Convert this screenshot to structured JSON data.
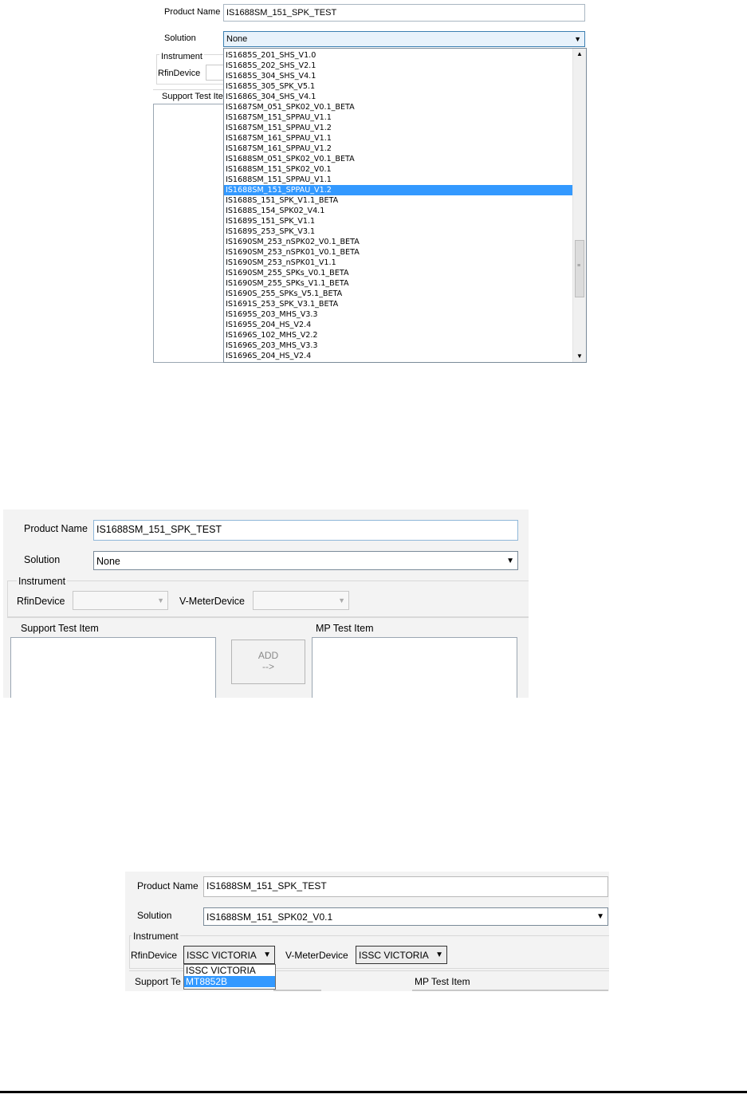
{
  "panel1": {
    "product_name_label": "Product Name",
    "product_name_value": "IS1688SM_151_SPK_TEST",
    "solution_label": "Solution",
    "solution_value": "None",
    "instrument_label": "Instrument",
    "rfin_label": "RfinDevice",
    "support_label": "Support Test Ite",
    "dropdown_items": [
      "IS1685S_201_SHS_V1.0",
      "IS1685S_202_SHS_V2.1",
      "IS1685S_304_SHS_V4.1",
      "IS1685S_305_SPK_V5.1",
      "IS1686S_304_SHS_V4.1",
      "IS1687SM_051_SPK02_V0.1_BETA",
      "IS1687SM_151_SPPAU_V1.1",
      "IS1687SM_151_SPPAU_V1.2",
      "IS1687SM_161_SPPAU_V1.1",
      "IS1687SM_161_SPPAU_V1.2",
      "IS1688SM_051_SPK02_V0.1_BETA",
      "IS1688SM_151_SPK02_V0.1",
      "IS1688SM_151_SPPAU_V1.1",
      "IS1688SM_151_SPPAU_V1.2",
      "IS1688S_151_SPK_V1.1_BETA",
      "IS1688S_154_SPK02_V4.1",
      "IS1689S_151_SPK_V1.1",
      "IS1689S_253_SPK_V3.1",
      "IS1690SM_253_nSPK02_V0.1_BETA",
      "IS1690SM_253_nSPK01_V0.1_BETA",
      "IS1690SM_253_nSPK01_V1.1",
      "IS1690SM_255_SPKs_V0.1_BETA",
      "IS1690SM_255_SPKs_V1.1_BETA",
      "IS1690S_255_SPKs_V5.1_BETA",
      "IS1691S_253_SPK_V3.1_BETA",
      "IS1695S_203_MHS_V3.3",
      "IS1695S_204_HS_V2.4",
      "IS1696S_102_MHS_V2.2",
      "IS1696S_203_MHS_V3.3",
      "IS1696S_204_HS_V2.4"
    ],
    "selected_item": "IS1688SM_151_SPPAU_V1.2"
  },
  "panel2": {
    "product_name_label": "Product Name",
    "product_name_value": "IS1688SM_151_SPK_TEST",
    "solution_label": "Solution",
    "solution_value": "None",
    "instrument_label": "Instrument",
    "rfin_label": "RfinDevice",
    "vmeter_label": "V-MeterDevice",
    "support_label": "Support Test Item",
    "add_button_line1": "ADD",
    "add_button_line2": "-->",
    "mp_label": "MP Test Item"
  },
  "panel3": {
    "product_name_label": "Product Name",
    "product_name_value": "IS1688SM_151_SPK_TEST",
    "solution_label": "Solution",
    "solution_value": "IS1688SM_151_SPK02_V0.1",
    "instrument_label": "Instrument",
    "rfin_label": "RfinDevice",
    "rfin_value": "ISSC VICTORIA",
    "vmeter_label": "V-MeterDevice",
    "vmeter_value": "ISSC VICTORIA",
    "rfin_options": [
      "ISSC VICTORIA",
      "MT8852B"
    ],
    "rfin_highlighted": "MT8852B",
    "support_label": "Support Te",
    "mp_label": "MP Test Item"
  },
  "colors": {
    "selection": "#3399ff",
    "panel_bg": "#f3f3f3"
  }
}
